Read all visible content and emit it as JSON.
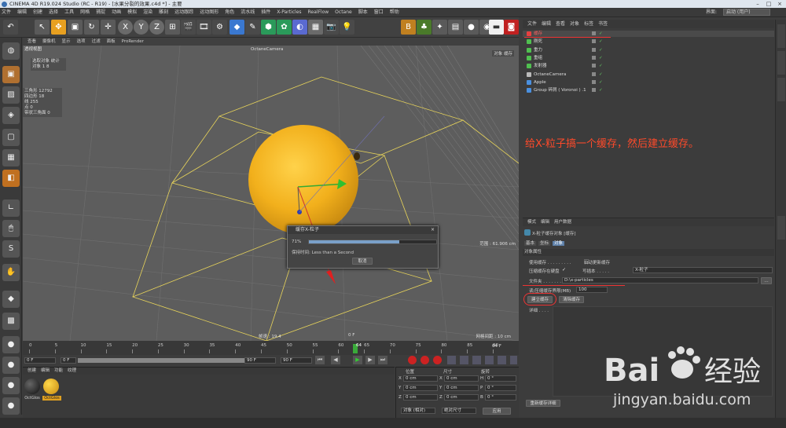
{
  "window": {
    "title": "CINEMA 4D R19.024 Studio (RC - R19) - [水果分裂的效果.c4d *] - 主要"
  },
  "menu": {
    "items": [
      "文件",
      "编辑",
      "创建",
      "选择",
      "工具",
      "网格",
      "捕捉",
      "动画",
      "模拟",
      "渲染",
      "雕刻",
      "运动跟踪",
      "运动图形",
      "角色",
      "流水线",
      "插件",
      "X-Particles",
      "RealFlow",
      "Octane",
      "脚本",
      "窗口",
      "帮助"
    ],
    "layout_label": "界面:",
    "layout_value": "启动 (用户)"
  },
  "viewport": {
    "menu": [
      "查看",
      "摄像机",
      "显示",
      "选项",
      "过滤",
      "面板",
      "ProRender"
    ],
    "view_name": "透视视图",
    "camera_label": "OctaneCamera",
    "top_right": "对象  缓存",
    "hud_title": "选取对象 统计",
    "hud_obj": "对象  1       8",
    "hud_stats": [
      "三角形    12792",
      "四边形    18",
      "线         255",
      "点         0",
      "带状三角面 0"
    ],
    "grid_dist": "网格间距 : 10 cm",
    "frame_rate": "帧速 : 19.4",
    "range_label": "范围 : 61.906 cm"
  },
  "dialog": {
    "title": "缓存X-粒子",
    "percent": "71%",
    "progress": 0.71,
    "remaining_label": "保持时间: Less than a Second",
    "cancel": "取消"
  },
  "timeline": {
    "ticks": [
      "0",
      "5",
      "10",
      "15",
      "20",
      "25",
      "30",
      "35",
      "40",
      "45",
      "50",
      "55",
      "60",
      "65",
      "70",
      "75",
      "80",
      "85",
      "90"
    ],
    "current": "64",
    "frame_end": "64 F",
    "field_start": "0 F",
    "field_min": "0 F",
    "field_max": "90 F",
    "field_end": "90 F",
    "vp_frame": "0 F"
  },
  "materials": {
    "menu": [
      "创建",
      "编辑",
      "功能",
      "纹理"
    ],
    "items": [
      {
        "name": "OctGlos"
      },
      {
        "name": "OctGlos"
      }
    ]
  },
  "coords": {
    "headers": [
      "位置",
      "尺寸",
      "旋转"
    ],
    "rows": [
      {
        "axis": "X",
        "pos": "0 cm",
        "size": "0 cm",
        "rot_label": "H",
        "rot": "0 °"
      },
      {
        "axis": "Y",
        "pos": "0 cm",
        "size": "0 cm",
        "rot_label": "P",
        "rot": "0 °"
      },
      {
        "axis": "Z",
        "pos": "0 cm",
        "size": "0 cm",
        "rot_label": "B",
        "rot": "0 °"
      }
    ],
    "mode": "对象 (相对)",
    "size_mode": "绝对尺寸",
    "apply": "应用"
  },
  "objects": {
    "menu": [
      "文件",
      "编辑",
      "查看",
      "对象",
      "标签",
      "书签"
    ],
    "rows": [
      {
        "name": "缓存",
        "color": "#e84040",
        "active": true
      },
      {
        "name": "刚死",
        "color": "#50c050"
      },
      {
        "name": "重力",
        "color": "#50c050"
      },
      {
        "name": "重组",
        "color": "#50c050"
      },
      {
        "name": "发射器",
        "color": "#50c050"
      },
      {
        "name": "OctaneCamera",
        "color": "#bbbbbb"
      },
      {
        "name": "Apple",
        "color": "#4a90e0"
      },
      {
        "name": "Group 碎屑 ( Voronoi ) .1",
        "color": "#4a90e0"
      }
    ]
  },
  "annotation": "给X-粒子搞一个缓存，然后建立缓存。",
  "attributes": {
    "menu": [
      "模式",
      "编辑",
      "用户数据"
    ],
    "object_title": "X-粒子缓存对象 [缓存]",
    "tabs": [
      "基本",
      "坐标",
      "对象"
    ],
    "section": "对象属性",
    "use_cache": "使用缓存 . . . . . . . . .",
    "auto_load": "自动更新缓存",
    "compress": "压缩缓存在硬盘",
    "writer_label": "写插本 . . . . .",
    "writer_value": "X-粒子",
    "file_label": "文件夹 . . . . . . . . .",
    "file_value": "D:\\x-particles",
    "mem_label": "读/压缩缓存界限(MB)",
    "mem_value": "100",
    "build_btn": "建立缓存",
    "clear_btn": "清除缓存",
    "info_label": "详细 . . . .",
    "reset_btn": "重新缓存详细"
  },
  "watermark": {
    "brand": "Bai",
    "brand2": "经验",
    "url": "jingyan.baidu.com"
  }
}
